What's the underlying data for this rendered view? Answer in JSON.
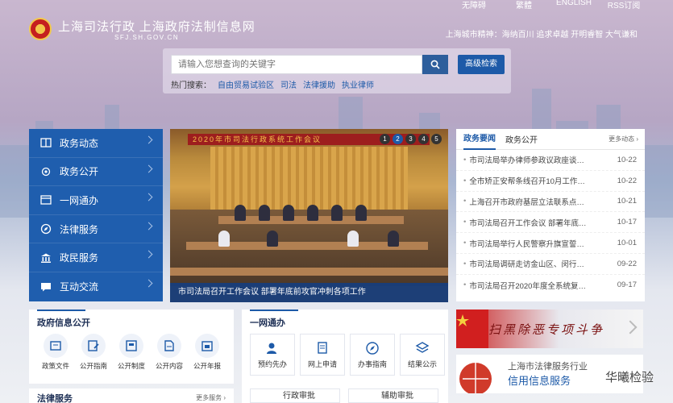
{
  "header": {
    "title": "上海司法行政  上海政府法制信息网",
    "subtitle": "SFJ.SH.GOV.CN",
    "top_links": [
      "无障碍",
      "繁體",
      "ENGLISH",
      "RSS订阅"
    ],
    "city_spirit": "上海城市精神：海纳百川 追求卓越 开明睿智 大气谦和"
  },
  "search": {
    "placeholder": "请输入您想查询的关键字",
    "advanced_label": "高级检索",
    "hot_label": "热门搜索：",
    "hot_terms": [
      "自由贸易试验区",
      "司法",
      "法律援助",
      "执业律师"
    ]
  },
  "sidebar": {
    "items": [
      {
        "label": "政务动态",
        "icon": "book-icon"
      },
      {
        "label": "政务公开",
        "icon": "gear-icon"
      },
      {
        "label": "一网通办",
        "icon": "window-icon"
      },
      {
        "label": "法律服务",
        "icon": "compass-icon"
      },
      {
        "label": "政民服务",
        "icon": "building-icon"
      },
      {
        "label": "互动交流",
        "icon": "chat-icon"
      }
    ]
  },
  "banner": {
    "stage_text": "2020年市司法行政系统工作会议",
    "caption": "市司法局召开工作会议 部署年底前攻官冲刺各项工作",
    "slides": [
      "1",
      "2",
      "3",
      "4",
      "5"
    ],
    "active_slide": 2
  },
  "news": {
    "tabs": [
      "政务要闻",
      "政务公开"
    ],
    "more": "更多动态",
    "items": [
      {
        "title": "市司法局举办律师参政议政座谈…",
        "date": "10-22"
      },
      {
        "title": "全市矫正安帮条线召开10月工作…",
        "date": "10-22"
      },
      {
        "title": "上海召开市政府基层立法联系点…",
        "date": "10-21"
      },
      {
        "title": "市司法局召开工作会议 部署年底…",
        "date": "10-17"
      },
      {
        "title": "市司法局举行人民警察升旗宣誓…",
        "date": "10-01"
      },
      {
        "title": "市司法局调研走访金山区、闵行…",
        "date": "09-22"
      },
      {
        "title": "市司法局召开2020年度全系统复…",
        "date": "09-17"
      }
    ]
  },
  "gov_info": {
    "title": "政府信息公开",
    "items": [
      "政策文件",
      "公开指南",
      "公开制度",
      "公开内容",
      "公开年报"
    ]
  },
  "ywt": {
    "title": "一网通办",
    "items": [
      "预约先办",
      "网上申请",
      "办事指南",
      "结果公示"
    ],
    "more_items": [
      "行政审批",
      "辅助审批"
    ]
  },
  "legal": {
    "title": "法律服务",
    "more": "更多服务"
  },
  "promos": {
    "crime": "扫黑除恶专项斗争",
    "credit_line1": "上海市法律服务行业",
    "credit_line2": "信用信息服务"
  },
  "watermark": "华曦检验",
  "colors": {
    "primary": "#1f5eae",
    "accent": "#1d5aa8",
    "banner_red": "#c82323"
  }
}
